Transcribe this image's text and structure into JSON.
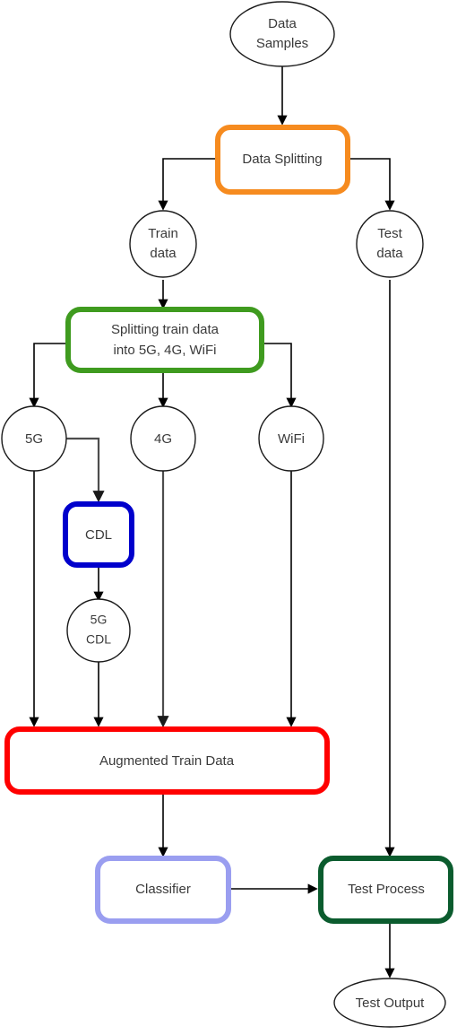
{
  "diagram": {
    "title": "Data augmentation and classification pipeline flowchart",
    "background": "#ffffff"
  },
  "colors": {
    "data_splitting_border": "#f68b1f",
    "splitting_train_border": "#3f9b1f",
    "cdl_border": "#0000cc",
    "augmented_border": "#ff0000",
    "classifier_border": "#9a9ef0",
    "test_process_border": "#0b5c2e",
    "terminal_border": "#1a1a1a",
    "edge": "#000000",
    "edge_gray": "#4d4d4d",
    "text": "#3a3a3a"
  },
  "nodes": {
    "data_samples": {
      "label_line1": "Data",
      "label_line2": "Samples",
      "shape": "ellipse"
    },
    "data_splitting": {
      "label": "Data Splitting",
      "shape": "rounded-rect"
    },
    "train_data": {
      "label_line1": "Train",
      "label_line2": "data",
      "shape": "circle"
    },
    "test_data": {
      "label_line1": "Test",
      "label_line2": "data",
      "shape": "circle"
    },
    "splitting_train_data": {
      "label_line1": "Splitting train data",
      "label_line2": "into 5G, 4G, WiFi",
      "shape": "rounded-rect"
    },
    "fiveg": {
      "label": "5G",
      "shape": "circle"
    },
    "fourg": {
      "label": "4G",
      "shape": "circle"
    },
    "wifi": {
      "label": "WiFi",
      "shape": "circle"
    },
    "cdl": {
      "label": "CDL",
      "shape": "rounded-rect"
    },
    "fiveg_cdl": {
      "label_line1": "5G",
      "label_line2": "CDL",
      "shape": "circle"
    },
    "augmented_train_data": {
      "label": "Augmented Train Data",
      "shape": "rounded-rect"
    },
    "classifier": {
      "label": "Classifier",
      "shape": "rounded-rect"
    },
    "test_process": {
      "label": "Test Process",
      "shape": "rounded-rect"
    },
    "test_output": {
      "label": "Test Output",
      "shape": "ellipse"
    }
  },
  "edges": [
    {
      "from": "data_samples",
      "to": "data_splitting"
    },
    {
      "from": "data_splitting",
      "to": "train_data"
    },
    {
      "from": "data_splitting",
      "to": "test_data"
    },
    {
      "from": "train_data",
      "to": "splitting_train_data"
    },
    {
      "from": "splitting_train_data",
      "to": "fiveg"
    },
    {
      "from": "splitting_train_data",
      "to": "fourg"
    },
    {
      "from": "splitting_train_data",
      "to": "wifi"
    },
    {
      "from": "fiveg",
      "to": "cdl"
    },
    {
      "from": "cdl",
      "to": "fiveg_cdl"
    },
    {
      "from": "fiveg",
      "to": "augmented_train_data"
    },
    {
      "from": "fiveg_cdl",
      "to": "augmented_train_data"
    },
    {
      "from": "fourg",
      "to": "augmented_train_data"
    },
    {
      "from": "wifi",
      "to": "augmented_train_data"
    },
    {
      "from": "augmented_train_data",
      "to": "classifier"
    },
    {
      "from": "classifier",
      "to": "test_process"
    },
    {
      "from": "test_data",
      "to": "test_process"
    },
    {
      "from": "test_process",
      "to": "test_output"
    }
  ]
}
